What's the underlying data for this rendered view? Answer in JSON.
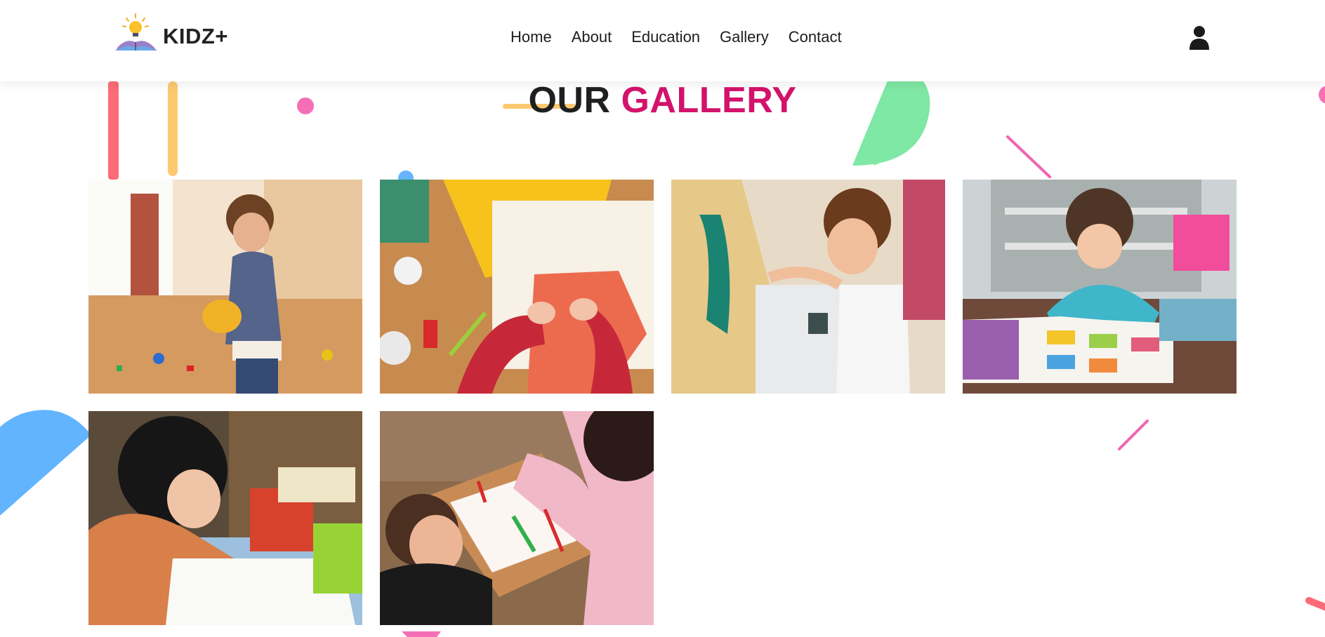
{
  "header": {
    "logo_text": "KIDZ+",
    "nav": [
      "Home",
      "About",
      "Education",
      "Gallery",
      "Contact"
    ]
  },
  "page": {
    "title_main": "OUR",
    "title_accent": "GALLERY"
  },
  "colors": {
    "accent": "#d3136b",
    "text": "#1f1f1f"
  },
  "gallery": {
    "images": [
      "toddler-playing-with-toys",
      "child-crafting-with-paper",
      "boy-painting-wood",
      "girl-reading-picture-book",
      "girl-writing-at-desk",
      "child-and-teacher-drawing"
    ]
  },
  "icons": {
    "logo": "lightbulb-book-icon",
    "user": "user-icon"
  }
}
